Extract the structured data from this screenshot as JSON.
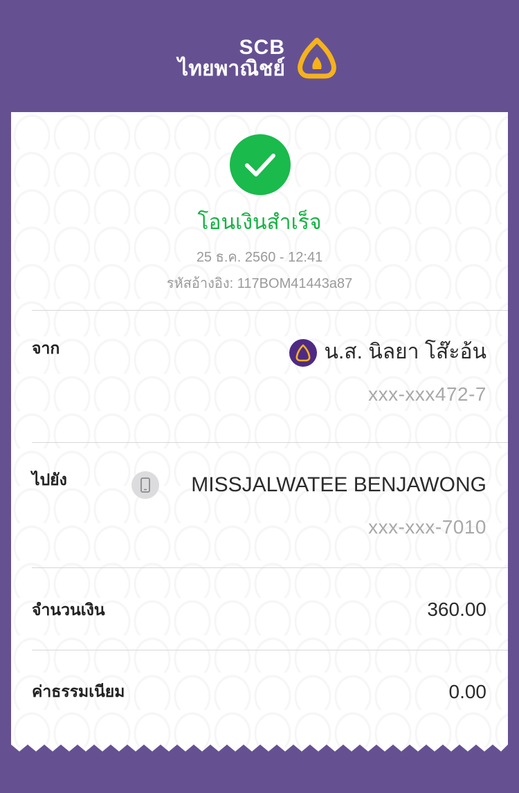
{
  "header": {
    "brand_en": "SCB",
    "brand_th": "ไทยพาณิชย์",
    "logo_icon": "scb-logo-icon"
  },
  "status": {
    "icon": "check-icon",
    "title": "โอนเงินสำเร็จ",
    "datetime": "25 ธ.ค. 2560 - 12:41",
    "reference": "รหัสอ้างอิง: 117BOM41443a87"
  },
  "from": {
    "label": "จาก",
    "name": "น.ส. นิลยา โส๊ะอ้น",
    "account": "xxx-xxx472-7",
    "icon": "scb-bank-icon"
  },
  "to": {
    "label": "ไปยัง",
    "name": "MISSJALWATEE BENJAWONG",
    "account": "xxx-xxx-7010",
    "icon": "mobile-phone-icon"
  },
  "amount": {
    "label": "จำนวนเงิน",
    "value": "360.00"
  },
  "fee": {
    "label": "ค่าธรรมเนียม",
    "value": "0.00"
  },
  "colors": {
    "background": "#655192",
    "success": "#1aba4c",
    "logo_gold": "#f6b21b"
  }
}
